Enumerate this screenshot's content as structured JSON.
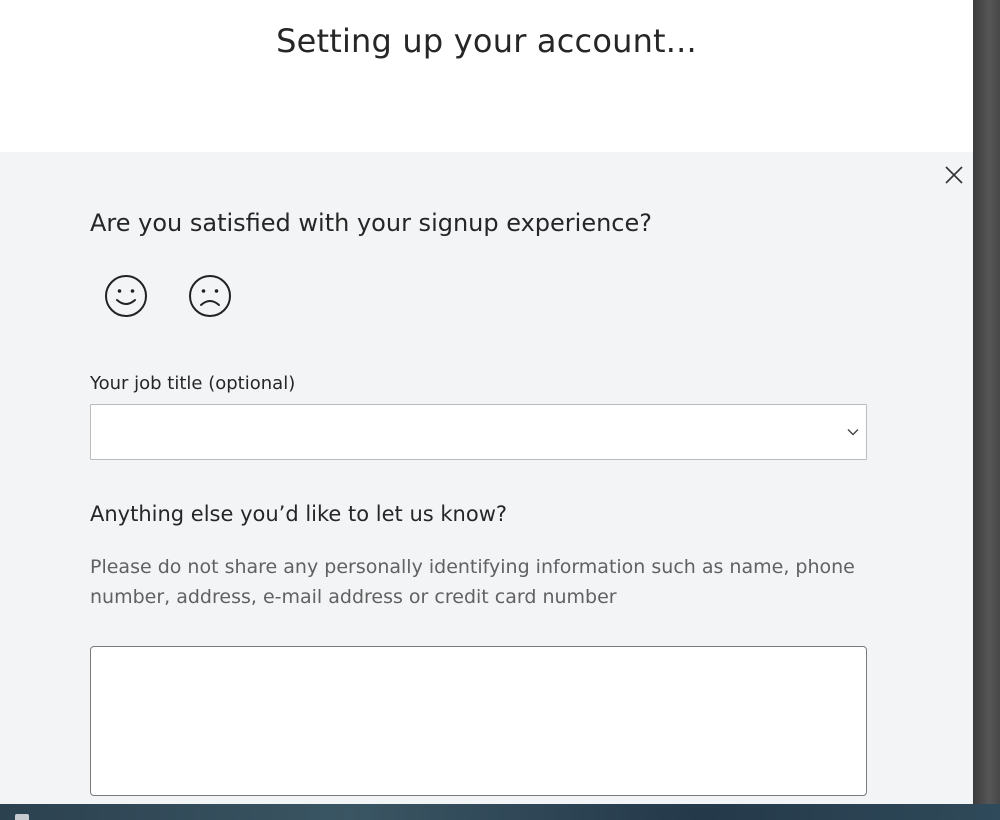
{
  "header": {
    "title": "Setting up your account..."
  },
  "feedback": {
    "close_icon": "close-icon",
    "question": "Are you satisfied with your signup experience?",
    "ratings": [
      {
        "icon": "smiley-happy-icon"
      },
      {
        "icon": "smiley-sad-icon"
      }
    ],
    "job_title": {
      "label": "Your job title (optional)",
      "value": ""
    },
    "comments": {
      "heading": "Anything else you’d like to let us know?",
      "disclaimer": "Please do not share any personally identifying information such as name, phone number, address, e-mail address or credit card number",
      "value": ""
    }
  },
  "colors": {
    "panel_background": "#f3f4f6",
    "text": "#262626",
    "muted_text": "#616161"
  }
}
